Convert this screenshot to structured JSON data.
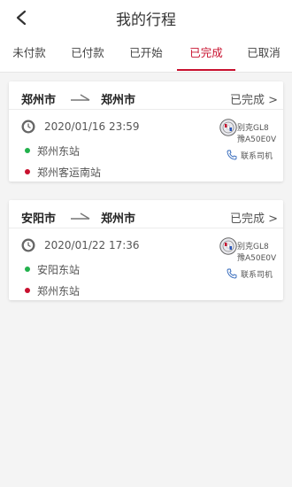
{
  "header": {
    "title": "我的行程",
    "back_icon": "chevron-left-icon"
  },
  "tabs": [
    {
      "label": "未付款",
      "active": false
    },
    {
      "label": "已付款",
      "active": false
    },
    {
      "label": "已开始",
      "active": false
    },
    {
      "label": "已完成",
      "active": true
    },
    {
      "label": "已取消",
      "active": false
    }
  ],
  "colors": {
    "accent": "#c8102e",
    "start_dot": "#22b14c",
    "end_dot": "#c8102e"
  },
  "trips": [
    {
      "from_city": "郑州市",
      "to_city": "郑州市",
      "status": "已完成 >",
      "datetime": "2020/01/16 23:59",
      "start_stop": "郑州东站",
      "end_stop": "郑州客运南站",
      "car_name": "别克GL8",
      "plate": "豫A50E0V",
      "contact_label": "联系司机"
    },
    {
      "from_city": "安阳市",
      "to_city": "郑州市",
      "status": "已完成 >",
      "datetime": "2020/01/22 17:36",
      "start_stop": "安阳东站",
      "end_stop": "郑州东站",
      "car_name": "别克GL8",
      "plate": "豫A50E0V",
      "contact_label": "联系司机"
    }
  ]
}
